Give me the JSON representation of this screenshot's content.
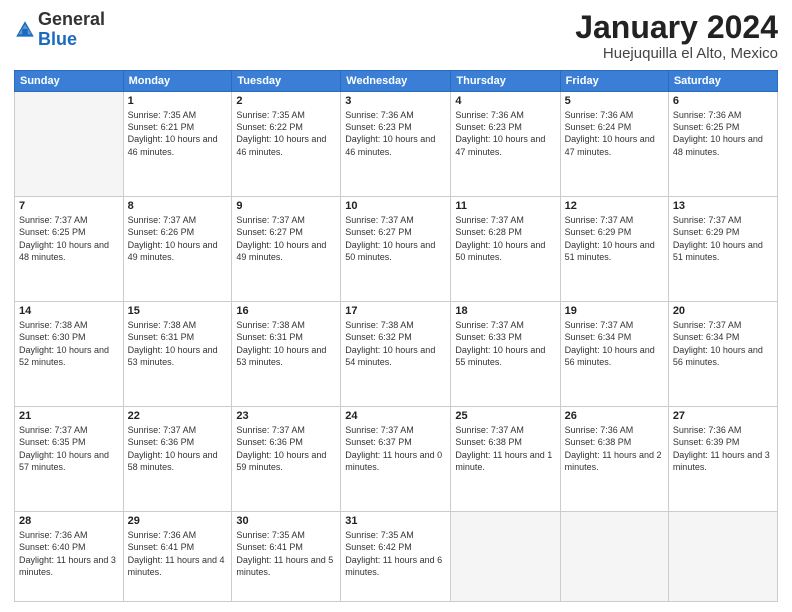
{
  "logo": {
    "general": "General",
    "blue": "Blue"
  },
  "header": {
    "month": "January 2024",
    "location": "Huejuquilla el Alto, Mexico"
  },
  "days_of_week": [
    "Sunday",
    "Monday",
    "Tuesday",
    "Wednesday",
    "Thursday",
    "Friday",
    "Saturday"
  ],
  "weeks": [
    [
      {
        "day": "",
        "empty": true
      },
      {
        "day": "1",
        "sunrise": "7:35 AM",
        "sunset": "6:21 PM",
        "daylight": "10 hours and 46 minutes."
      },
      {
        "day": "2",
        "sunrise": "7:35 AM",
        "sunset": "6:22 PM",
        "daylight": "10 hours and 46 minutes."
      },
      {
        "day": "3",
        "sunrise": "7:36 AM",
        "sunset": "6:23 PM",
        "daylight": "10 hours and 46 minutes."
      },
      {
        "day": "4",
        "sunrise": "7:36 AM",
        "sunset": "6:23 PM",
        "daylight": "10 hours and 47 minutes."
      },
      {
        "day": "5",
        "sunrise": "7:36 AM",
        "sunset": "6:24 PM",
        "daylight": "10 hours and 47 minutes."
      },
      {
        "day": "6",
        "sunrise": "7:36 AM",
        "sunset": "6:25 PM",
        "daylight": "10 hours and 48 minutes."
      }
    ],
    [
      {
        "day": "7",
        "sunrise": "7:37 AM",
        "sunset": "6:25 PM",
        "daylight": "10 hours and 48 minutes."
      },
      {
        "day": "8",
        "sunrise": "7:37 AM",
        "sunset": "6:26 PM",
        "daylight": "10 hours and 49 minutes."
      },
      {
        "day": "9",
        "sunrise": "7:37 AM",
        "sunset": "6:27 PM",
        "daylight": "10 hours and 49 minutes."
      },
      {
        "day": "10",
        "sunrise": "7:37 AM",
        "sunset": "6:27 PM",
        "daylight": "10 hours and 50 minutes."
      },
      {
        "day": "11",
        "sunrise": "7:37 AM",
        "sunset": "6:28 PM",
        "daylight": "10 hours and 50 minutes."
      },
      {
        "day": "12",
        "sunrise": "7:37 AM",
        "sunset": "6:29 PM",
        "daylight": "10 hours and 51 minutes."
      },
      {
        "day": "13",
        "sunrise": "7:37 AM",
        "sunset": "6:29 PM",
        "daylight": "10 hours and 51 minutes."
      }
    ],
    [
      {
        "day": "14",
        "sunrise": "7:38 AM",
        "sunset": "6:30 PM",
        "daylight": "10 hours and 52 minutes."
      },
      {
        "day": "15",
        "sunrise": "7:38 AM",
        "sunset": "6:31 PM",
        "daylight": "10 hours and 53 minutes."
      },
      {
        "day": "16",
        "sunrise": "7:38 AM",
        "sunset": "6:31 PM",
        "daylight": "10 hours and 53 minutes."
      },
      {
        "day": "17",
        "sunrise": "7:38 AM",
        "sunset": "6:32 PM",
        "daylight": "10 hours and 54 minutes."
      },
      {
        "day": "18",
        "sunrise": "7:37 AM",
        "sunset": "6:33 PM",
        "daylight": "10 hours and 55 minutes."
      },
      {
        "day": "19",
        "sunrise": "7:37 AM",
        "sunset": "6:34 PM",
        "daylight": "10 hours and 56 minutes."
      },
      {
        "day": "20",
        "sunrise": "7:37 AM",
        "sunset": "6:34 PM",
        "daylight": "10 hours and 56 minutes."
      }
    ],
    [
      {
        "day": "21",
        "sunrise": "7:37 AM",
        "sunset": "6:35 PM",
        "daylight": "10 hours and 57 minutes."
      },
      {
        "day": "22",
        "sunrise": "7:37 AM",
        "sunset": "6:36 PM",
        "daylight": "10 hours and 58 minutes."
      },
      {
        "day": "23",
        "sunrise": "7:37 AM",
        "sunset": "6:36 PM",
        "daylight": "10 hours and 59 minutes."
      },
      {
        "day": "24",
        "sunrise": "7:37 AM",
        "sunset": "6:37 PM",
        "daylight": "11 hours and 0 minutes."
      },
      {
        "day": "25",
        "sunrise": "7:37 AM",
        "sunset": "6:38 PM",
        "daylight": "11 hours and 1 minute."
      },
      {
        "day": "26",
        "sunrise": "7:36 AM",
        "sunset": "6:38 PM",
        "daylight": "11 hours and 2 minutes."
      },
      {
        "day": "27",
        "sunrise": "7:36 AM",
        "sunset": "6:39 PM",
        "daylight": "11 hours and 3 minutes."
      }
    ],
    [
      {
        "day": "28",
        "sunrise": "7:36 AM",
        "sunset": "6:40 PM",
        "daylight": "11 hours and 3 minutes."
      },
      {
        "day": "29",
        "sunrise": "7:36 AM",
        "sunset": "6:41 PM",
        "daylight": "11 hours and 4 minutes."
      },
      {
        "day": "30",
        "sunrise": "7:35 AM",
        "sunset": "6:41 PM",
        "daylight": "11 hours and 5 minutes."
      },
      {
        "day": "31",
        "sunrise": "7:35 AM",
        "sunset": "6:42 PM",
        "daylight": "11 hours and 6 minutes."
      },
      {
        "day": "",
        "empty": true
      },
      {
        "day": "",
        "empty": true
      },
      {
        "day": "",
        "empty": true
      }
    ]
  ],
  "labels": {
    "sunrise": "Sunrise:",
    "sunset": "Sunset:",
    "daylight": "Daylight:"
  }
}
